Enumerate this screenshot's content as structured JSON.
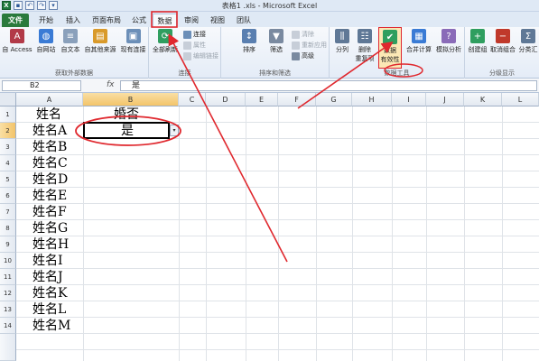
{
  "window": {
    "title": "表格1 .xls - Microsoft Excel"
  },
  "tabs": [
    "文件",
    "开始",
    "插入",
    "页面布局",
    "公式",
    "数据",
    "审阅",
    "视图",
    "团队"
  ],
  "ribbon": {
    "get_external": {
      "label": "获取外部数据",
      "buttons": [
        "自 Access",
        "自网站",
        "自文本",
        "自其他来源",
        "现有连接"
      ]
    },
    "connections": {
      "label": "连接",
      "refresh_all": "全部刷新",
      "items": [
        "连接",
        "属性",
        "编辑链接"
      ]
    },
    "sort_filter": {
      "label": "排序和筛选",
      "sort": "排序",
      "filter": "筛选",
      "items": [
        "清除",
        "重新应用",
        "高级"
      ]
    },
    "data_tools": {
      "label": "数据工具",
      "buttons": [
        "分列",
        "删除",
        "数据",
        "合并计算",
        "模拟分析"
      ],
      "sub": [
        "重复项",
        "有效性"
      ]
    },
    "outline": {
      "label": "分级显示",
      "buttons": [
        "创建组",
        "取消组合",
        "分类汇"
      ]
    }
  },
  "formula_bar": {
    "name_box": "B2",
    "fx": "fx",
    "content": "是"
  },
  "columns": [
    "A",
    "B",
    "C",
    "D",
    "E",
    "F",
    "G",
    "H",
    "I",
    "J",
    "K",
    "L"
  ],
  "rows": [
    "1",
    "2",
    "3",
    "4",
    "5",
    "6",
    "7",
    "8",
    "9",
    "10",
    "11",
    "12",
    "13",
    "14"
  ],
  "cells": {
    "a": [
      "姓名",
      "姓名A",
      "姓名B",
      "姓名C",
      "姓名D",
      "姓名E",
      "姓名F",
      "姓名G",
      "姓名H",
      "姓名I",
      "姓名J",
      "姓名K",
      "姓名L",
      "姓名M"
    ],
    "b1": "婚否",
    "b2": "是"
  },
  "colors": {
    "annotation": "#e0282e",
    "file_tab": "#2a7a3c",
    "selection_header": "#f3c46a"
  }
}
